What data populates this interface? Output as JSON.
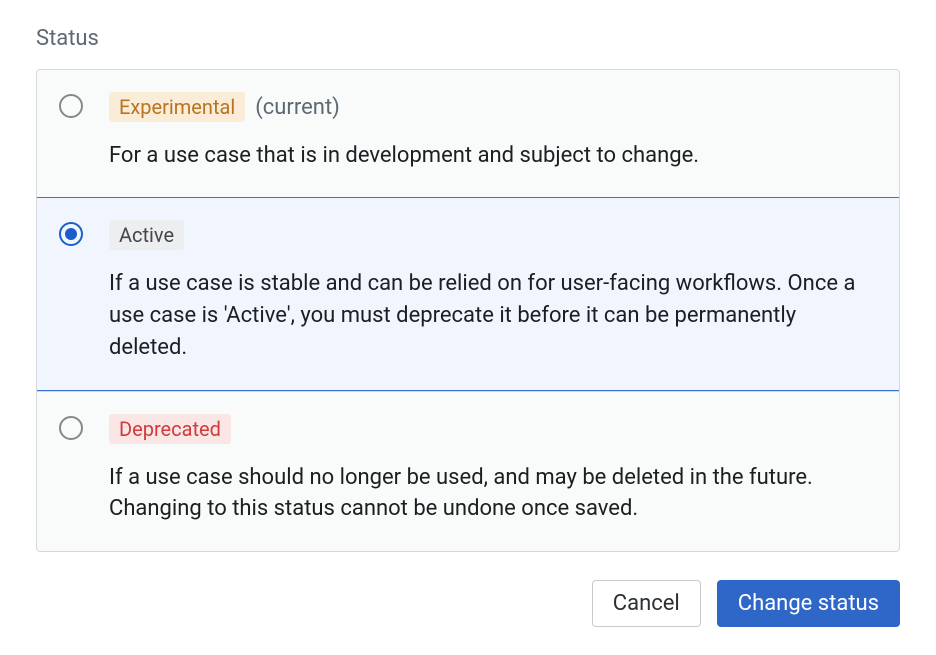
{
  "section_title": "Status",
  "options": {
    "experimental": {
      "badge": "Experimental",
      "current": "(current)",
      "description": "For a use case that is in development and subject to change."
    },
    "active": {
      "badge": "Active",
      "description": "If a use case is stable and can be relied on for user-facing workflows. Once a use case is 'Active', you must deprecate it before it can be permanently deleted."
    },
    "deprecated": {
      "badge": "Deprecated",
      "description": "If a use case should no longer be used, and may be deleted in the future. Changing to this status cannot be undone once saved."
    }
  },
  "buttons": {
    "cancel": "Cancel",
    "submit": "Change status"
  }
}
